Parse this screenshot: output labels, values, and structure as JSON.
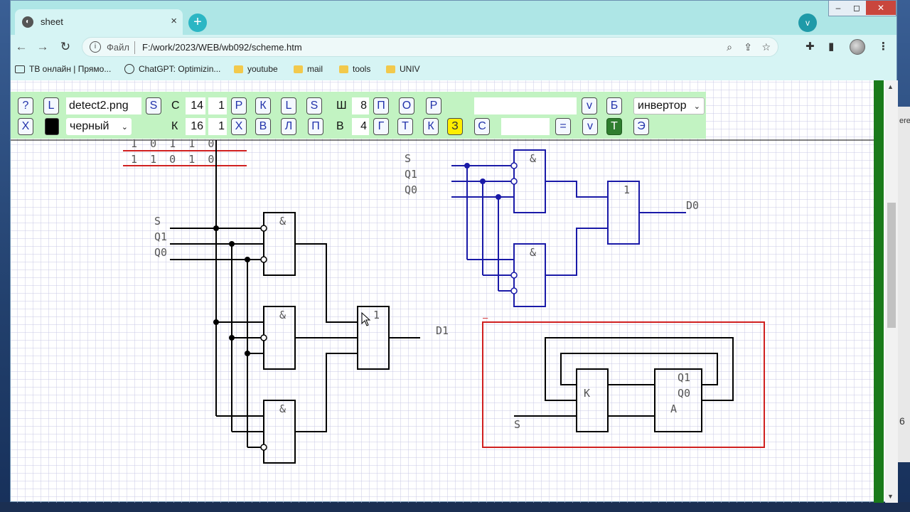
{
  "browser": {
    "tab_title": "sheet",
    "tab_close": "×",
    "new_tab": "+",
    "profile_chip": "v",
    "window_controls": {
      "minimize": "–",
      "maximize": "◻",
      "close": "✕"
    },
    "nav": {
      "back": "←",
      "forward": "→",
      "reload": "↻"
    },
    "address": {
      "info": "i",
      "scheme_label": "Файл",
      "url": "F:/work/2023/WEB/wb092/scheme.htm"
    },
    "bookmarks": [
      {
        "label": "ТВ онлайн | Прямо...",
        "icon": "tv-icon"
      },
      {
        "label": "ChatGPT: Optimizin...",
        "icon": "chatgpt-icon"
      },
      {
        "label": "youtube",
        "icon": "folder-icon"
      },
      {
        "label": "mail",
        "icon": "folder-icon"
      },
      {
        "label": "tools",
        "icon": "folder-icon"
      },
      {
        "label": "UNIV",
        "icon": "folder-icon"
      }
    ]
  },
  "toolbar": {
    "row1": {
      "help": "?",
      "load": "L",
      "filename": "detect2.png",
      "save": "S",
      "c_label": "С",
      "c_value": "14",
      "c_step": "1",
      "b_p": "Р",
      "b_k": "К",
      "b_l": "L",
      "b_s": "S",
      "w_label": "Ш",
      "w_value": "8",
      "b_pp": "П",
      "b_o": "О",
      "b_r": "Р",
      "text_input": "",
      "b_v": "v",
      "b_b": "Б",
      "element_select": "инвертор"
    },
    "row2": {
      "clear": "X",
      "color_select": "черный",
      "k_label": "К",
      "k_value": "16",
      "k_step": "1",
      "b_x": "Х",
      "b_v": "В",
      "b_l": "Л",
      "b_p": "П",
      "h_label": "В",
      "h_value": "4",
      "b_g": "Г",
      "b_t": "Т",
      "b_k": "К",
      "b_z": "З",
      "b_s": "С",
      "text_input": "",
      "b_eq": "=",
      "b_v2": "v",
      "b_t2": "Т",
      "b_e": "Э"
    }
  },
  "scheme": {
    "truth_rows": [
      "1  0  1  1  0",
      "1  1  0  1  0"
    ],
    "black": {
      "inputs": [
        "S",
        "Q1",
        "Q0"
      ],
      "and": "&",
      "or": "1",
      "output": "D1"
    },
    "blue": {
      "inputs": [
        "S",
        "Q1",
        "Q0"
      ],
      "and": "&",
      "or": "1",
      "output": "D0"
    },
    "red": {
      "marker": "–",
      "k_block": "K",
      "a_labels": [
        "Q1",
        "Q0",
        "A"
      ],
      "input": "S"
    }
  },
  "desktop": {
    "strip_labels": [
      "ere",
      "6"
    ]
  },
  "colors": {
    "accent": "#2bb6c4",
    "browser_chrome": "#aee6e6",
    "toolbar": "#c2f3c2",
    "scheme_blue": "#1a1aa8",
    "scheme_red": "#d02020",
    "grid": "#c8c8e6"
  }
}
